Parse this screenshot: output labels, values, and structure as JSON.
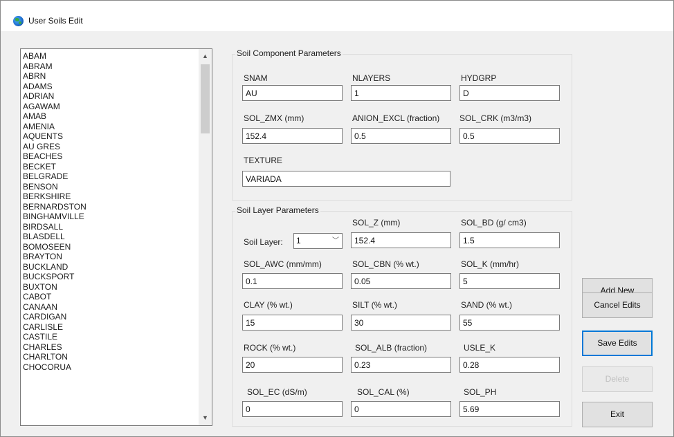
{
  "window": {
    "title": "User Soils Edit",
    "icon": "globe-icon"
  },
  "soil_list": {
    "items": [
      "ABAM",
      "ABRAM",
      "ABRN",
      "ADAMS",
      "ADRIAN",
      "AGAWAM",
      "AMAB",
      "AMENIA",
      "AQUENTS",
      "AU GRES",
      "BEACHES",
      "BECKET",
      "BELGRADE",
      "BENSON",
      "BERKSHIRE",
      "BERNARDSTON",
      "BINGHAMVILLE",
      "BIRDSALL",
      "BLASDELL",
      "BOMOSEEN",
      "BRAYTON",
      "BUCKLAND",
      "BUCKSPORT",
      "BUXTON",
      "CABOT",
      "CANAAN",
      "CARDIGAN",
      "CARLISLE",
      "CASTILE",
      "CHARLES",
      "CHARLTON",
      "CHOCORUA"
    ]
  },
  "component": {
    "group_label": "Soil Component Parameters",
    "snam": {
      "label": "SNAM",
      "value": "AU"
    },
    "nlayers": {
      "label": "NLAYERS",
      "value": "1"
    },
    "hydgrp": {
      "label": "HYDGRP",
      "value": "D"
    },
    "sol_zmx": {
      "label": "SOL_ZMX (mm)",
      "value": "152.4"
    },
    "anion_excl": {
      "label": "ANION_EXCL (fraction)",
      "value": "0.5"
    },
    "sol_crk": {
      "label": "SOL_CRK (m3/m3)",
      "value": "0.5"
    },
    "texture": {
      "label": "TEXTURE",
      "value": "VARIADA"
    }
  },
  "layer": {
    "group_label": "Soil Layer Parameters",
    "soil_layer": {
      "label": "Soil Layer:",
      "value": "1"
    },
    "sol_z": {
      "label": "SOL_Z (mm)",
      "value": "152.4"
    },
    "sol_bd": {
      "label": "SOL_BD (g/ cm3)",
      "value": "1.5"
    },
    "sol_awc": {
      "label": "SOL_AWC (mm/mm)",
      "value": "0.1"
    },
    "sol_cbn": {
      "label": "SOL_CBN (% wt.)",
      "value": "0.05"
    },
    "sol_k": {
      "label": "SOL_K (mm/hr)",
      "value": "5"
    },
    "clay": {
      "label": "CLAY (% wt.)",
      "value": "15"
    },
    "silt": {
      "label": "SILT (% wt.)",
      "value": "30"
    },
    "sand": {
      "label": "SAND (% wt.)",
      "value": "55"
    },
    "rock": {
      "label": "ROCK (% wt.)",
      "value": "20"
    },
    "sol_alb": {
      "label": "SOL_ALB (fraction)",
      "value": "0.23"
    },
    "usle_k": {
      "label": "USLE_K",
      "value": "0.28"
    },
    "sol_ec": {
      "label": "SOL_EC (dS/m)",
      "value": "0"
    },
    "sol_cal": {
      "label": "SOL_CAL (%)",
      "value": "0"
    },
    "sol_ph": {
      "label": "SOL_PH",
      "value": "5.69"
    }
  },
  "buttons": {
    "add_new": "Add New",
    "cancel_edits": "Cancel Edits",
    "save_edits": "Save Edits",
    "delete": "Delete",
    "exit": "Exit"
  }
}
